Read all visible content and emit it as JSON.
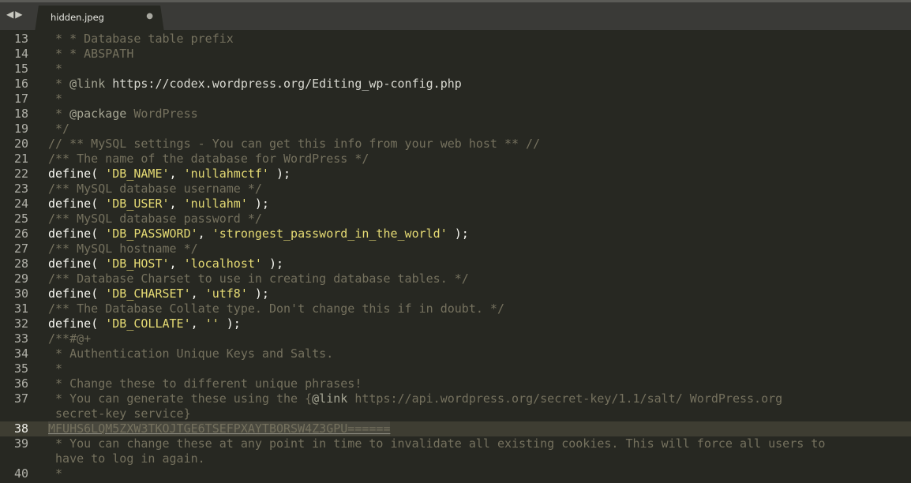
{
  "nav": {
    "back": "◀",
    "forward": "▶"
  },
  "tab": {
    "title": "hidden.jpeg",
    "close": "●"
  },
  "lines": [
    {
      "n": "13",
      "segs": [
        [
          "cmt",
          " * * Database table prefix"
        ]
      ]
    },
    {
      "n": "14",
      "segs": [
        [
          "cmt",
          " * * ABSPATH"
        ]
      ]
    },
    {
      "n": "15",
      "segs": [
        [
          "cmt",
          " *"
        ]
      ]
    },
    {
      "n": "16",
      "segs": [
        [
          "cmt",
          " * "
        ],
        [
          "doctag",
          "@link"
        ],
        [
          "url",
          " https://codex.wordpress.org/Editing_wp-config.php"
        ]
      ]
    },
    {
      "n": "17",
      "segs": [
        [
          "cmt",
          " *"
        ]
      ]
    },
    {
      "n": "18",
      "segs": [
        [
          "cmt",
          " * "
        ],
        [
          "doctag",
          "@package"
        ],
        [
          "cmt",
          " WordPress"
        ]
      ]
    },
    {
      "n": "19",
      "segs": [
        [
          "cmt",
          " */"
        ]
      ]
    },
    {
      "n": "20",
      "segs": [
        [
          "cmt",
          "// ** MySQL settings - You can get this info from your web host ** //"
        ]
      ]
    },
    {
      "n": "21",
      "segs": [
        [
          "cmt",
          "/** The name of the database for WordPress */"
        ]
      ]
    },
    {
      "n": "22",
      "segs": [
        [
          "kw",
          "define"
        ],
        [
          "plain",
          "( "
        ],
        [
          "str",
          "'DB_NAME'"
        ],
        [
          "plain",
          ", "
        ],
        [
          "str",
          "'nullahmctf'"
        ],
        [
          "plain",
          " );"
        ]
      ]
    },
    {
      "n": "23",
      "segs": [
        [
          "cmt",
          "/** MySQL database username */"
        ]
      ]
    },
    {
      "n": "24",
      "segs": [
        [
          "kw",
          "define"
        ],
        [
          "plain",
          "( "
        ],
        [
          "str",
          "'DB_USER'"
        ],
        [
          "plain",
          ", "
        ],
        [
          "str",
          "'nullahm'"
        ],
        [
          "plain",
          " );"
        ]
      ]
    },
    {
      "n": "25",
      "segs": [
        [
          "cmt",
          "/** MySQL database password */"
        ]
      ]
    },
    {
      "n": "26",
      "segs": [
        [
          "kw",
          "define"
        ],
        [
          "plain",
          "( "
        ],
        [
          "str",
          "'DB_PASSWORD'"
        ],
        [
          "plain",
          ", "
        ],
        [
          "str",
          "'strongest_password_in_the_world'"
        ],
        [
          "plain",
          " );"
        ]
      ]
    },
    {
      "n": "27",
      "segs": [
        [
          "cmt",
          "/** MySQL hostname */"
        ]
      ]
    },
    {
      "n": "28",
      "segs": [
        [
          "kw",
          "define"
        ],
        [
          "plain",
          "( "
        ],
        [
          "str",
          "'DB_HOST'"
        ],
        [
          "plain",
          ", "
        ],
        [
          "str",
          "'localhost'"
        ],
        [
          "plain",
          " );"
        ]
      ]
    },
    {
      "n": "29",
      "segs": [
        [
          "cmt",
          "/** Database Charset to use in creating database tables. */"
        ]
      ]
    },
    {
      "n": "30",
      "segs": [
        [
          "kw",
          "define"
        ],
        [
          "plain",
          "( "
        ],
        [
          "str",
          "'DB_CHARSET'"
        ],
        [
          "plain",
          ", "
        ],
        [
          "str",
          "'utf8'"
        ],
        [
          "plain",
          " );"
        ]
      ]
    },
    {
      "n": "31",
      "segs": [
        [
          "cmt",
          "/** The Database Collate type. Don't change this if in doubt. */"
        ]
      ]
    },
    {
      "n": "32",
      "segs": [
        [
          "kw",
          "define"
        ],
        [
          "plain",
          "( "
        ],
        [
          "str",
          "'DB_COLLATE'"
        ],
        [
          "plain",
          ", "
        ],
        [
          "str",
          "''"
        ],
        [
          "plain",
          " );"
        ]
      ]
    },
    {
      "n": "33",
      "segs": [
        [
          "cmt",
          "/**#@+"
        ]
      ]
    },
    {
      "n": "34",
      "segs": [
        [
          "cmt",
          " * Authentication Unique Keys and Salts."
        ]
      ]
    },
    {
      "n": "35",
      "segs": [
        [
          "cmt",
          " *"
        ]
      ]
    },
    {
      "n": "36",
      "segs": [
        [
          "cmt",
          " * Change these to different unique phrases!"
        ]
      ]
    },
    {
      "n": "37",
      "segs": [
        [
          "cmt",
          " * You can generate these using the {"
        ],
        [
          "doctag",
          "@link"
        ],
        [
          "cmt",
          " https://api.wordpress.org/secret-key/1.1/salt/ WordPress.org"
        ]
      ]
    },
    {
      "n": "",
      "segs": [
        [
          "cmt",
          " secret-key service}"
        ]
      ]
    },
    {
      "n": "38",
      "active": true,
      "segs": [
        [
          "sel",
          "MFUHS6LQM5ZXW3TKOJTGE6TSEFPXAYTBORSW4Z3GPU======"
        ]
      ]
    },
    {
      "n": "39",
      "segs": [
        [
          "cmt",
          " * You can change these at any point in time to invalidate all existing cookies. This will force all users to"
        ]
      ]
    },
    {
      "n": "",
      "segs": [
        [
          "cmt",
          " have to log in again."
        ]
      ]
    },
    {
      "n": "40",
      "segs": [
        [
          "cmt",
          " *"
        ]
      ]
    }
  ]
}
